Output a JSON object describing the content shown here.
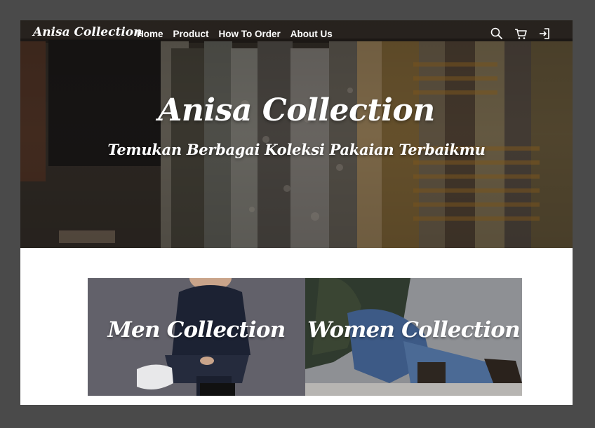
{
  "brand": "Anisa Collection",
  "nav": {
    "links": [
      "Home",
      "Product",
      "How To Order",
      "About Us"
    ],
    "icons": [
      "search-icon",
      "cart-icon",
      "login-icon"
    ]
  },
  "hero": {
    "title": "Anisa Collection",
    "subtitle": "Temukan Berbagai Koleksi Pakaian Terbaikmu"
  },
  "collections": [
    {
      "label": "Men Collection"
    },
    {
      "label": "Women Collection"
    }
  ],
  "colors": {
    "page_background": "#4a4a4a",
    "content_background": "#ffffff",
    "text_on_image": "#ffffff"
  }
}
